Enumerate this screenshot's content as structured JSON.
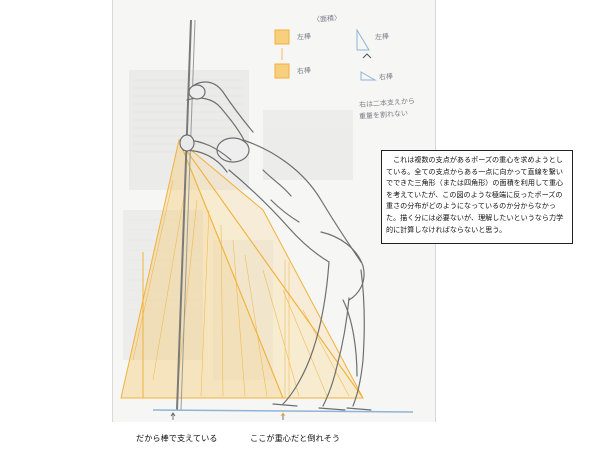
{
  "note": {
    "text": "　これは複数の支点があるポーズの重心を求めようとしている。全ての支点からある一点に向かって直線を繋いでできた三角形（または四角形）の面積を利用して重心を考えていたが、この図のような極端に反ったポーズの重さの分布がどのようになっているのか分からなかった。描く分には必要ないが、理解したいというなら力学的に計算しなければならないと思う。"
  },
  "captions": {
    "left": "だから棒で支えている",
    "right": "ここが重心だと倒れそう"
  },
  "sketch_notes": {
    "header": "〈面積〉",
    "left_area": "左棒",
    "right_area": "右棒",
    "left_stick": "左棒",
    "right_stick": "右棒",
    "memo_line1": "右は二本支えから",
    "memo_line2": "重量を割れない"
  },
  "colors": {
    "paper": "#f6f6f4",
    "pencil": "#8a8a8a",
    "orange": "#f2b23a",
    "orange_fill": "#f7cf7e",
    "blue": "#8fb4d9"
  }
}
